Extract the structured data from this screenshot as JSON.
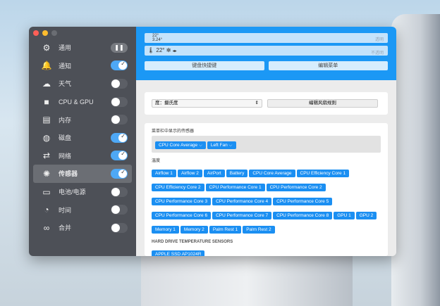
{
  "sidebar": {
    "items": [
      {
        "label": "通用",
        "icon": "gear-icon",
        "state": "pause"
      },
      {
        "label": "通知",
        "icon": "bell-icon",
        "state": "on"
      },
      {
        "label": "天气",
        "icon": "weather-icon",
        "state": "off"
      },
      {
        "label": "CPU & GPU",
        "icon": "cpu-icon",
        "state": "off"
      },
      {
        "label": "内存",
        "icon": "memory-icon",
        "state": "off"
      },
      {
        "label": "磁盘",
        "icon": "disk-icon",
        "state": "on"
      },
      {
        "label": "网络",
        "icon": "network-icon",
        "state": "on"
      },
      {
        "label": "传感器",
        "icon": "sensor-icon",
        "state": "on"
      },
      {
        "label": "电池/电源",
        "icon": "battery-icon",
        "state": "off"
      },
      {
        "label": "时间",
        "icon": "clock-icon",
        "state": "off"
      },
      {
        "label": "合并",
        "icon": "combine-icon",
        "state": "off"
      }
    ]
  },
  "preview": {
    "row1_line1": "22°",
    "row1_line2": "3.24°",
    "row1_right": "透明",
    "row2_text": "22°",
    "row2_right": "不透明"
  },
  "buttons": {
    "shortcuts": "键盘快捷键",
    "edit_menu": "编辑菜单"
  },
  "settings": {
    "unit_select": "度：摄氏度",
    "edit_fan_rules": "编辑风扇规则"
  },
  "menubar_sensors": {
    "title": "菜单栏中显示的传感器",
    "items": [
      "CPU Core Average ⌵",
      "Left Fan ⌵"
    ]
  },
  "temperature": {
    "title": "温度",
    "items": [
      "Airflow 1",
      "Airflow 2",
      "AirPort",
      "Battery",
      "CPU Core Average",
      "CPU Efficiency Core 1",
      "CPU Efficiency Core 2",
      "CPU Performance Core 1",
      "CPU Performance Core 2",
      "CPU Performance Core 3",
      "CPU Performance Core 4",
      "CPU Performance Core 5",
      "CPU Performance Core 6",
      "CPU Performance Core 7",
      "CPU Performance Core 8",
      "GPU 1",
      "GPU 2",
      "Memory 1",
      "Memory 2",
      "Palm Rest 1",
      "Palm Rest 2"
    ]
  },
  "hdd": {
    "title": "HARD DRIVE TEMPERATURE SENSORS",
    "items": [
      "APPLE SSD AP1024R"
    ]
  },
  "fans": {
    "title": "风扇"
  }
}
